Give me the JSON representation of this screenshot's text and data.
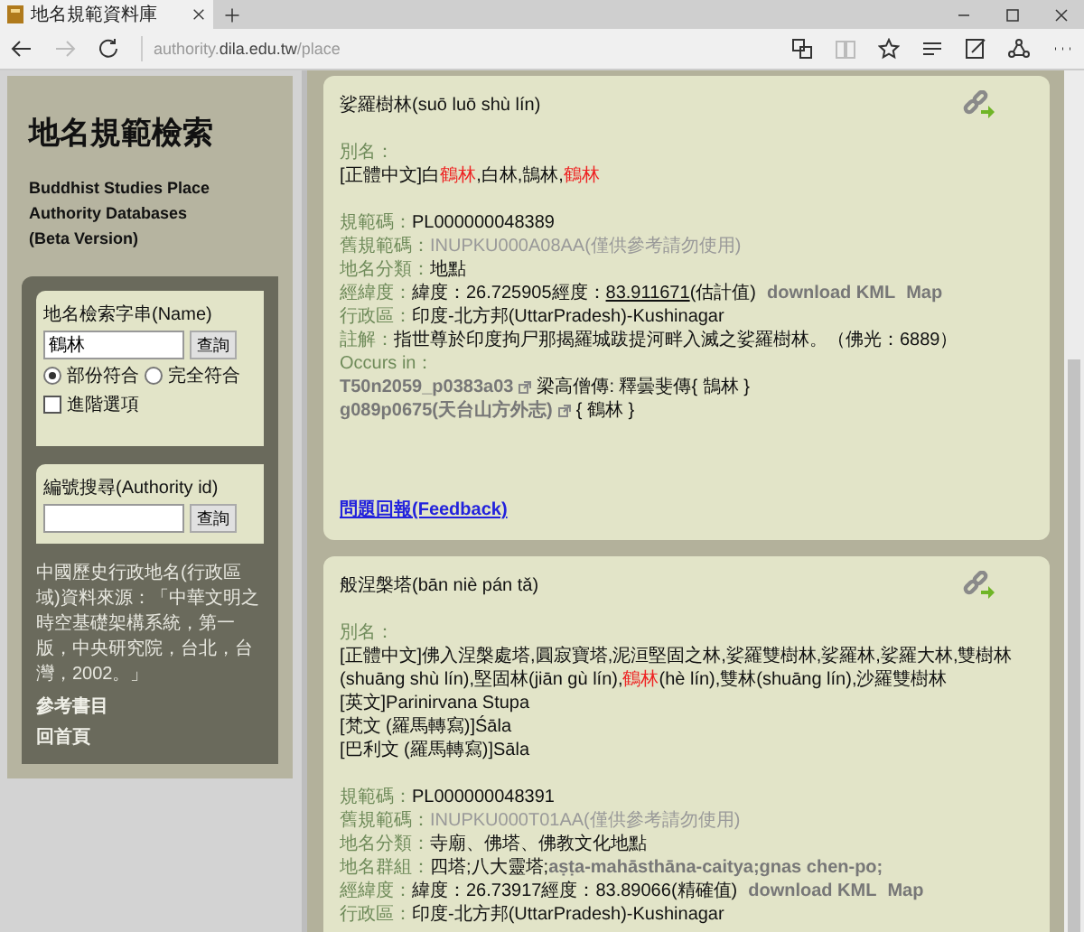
{
  "browser": {
    "tab_title": "地名規範資料庫",
    "url": {
      "prefix": "authority.",
      "domain": "dila.edu.tw",
      "path": "/place"
    }
  },
  "sidebar": {
    "title": "地名規範檢索",
    "subtitle": [
      "Buddhist Studies Place Authority Databases",
      "(Beta Version)"
    ],
    "name_search": {
      "label": "地名檢索字串(Name)",
      "value": "鶴林",
      "button": "查詢",
      "match_options": [
        {
          "label": "部份符合",
          "selected": true
        },
        {
          "label": "完全符合",
          "selected": false
        }
      ],
      "advanced": {
        "label": "進階選項",
        "checked": false
      }
    },
    "id_search": {
      "label": "編號搜尋(Authority id)",
      "button": "查詢"
    },
    "source_note": "中國歷史行政地名(行政區域)資料來源：「中華文明之時空基礎架構系統，第一版，中央研究院，台北，台灣，2002。」",
    "links": [
      "參考書目",
      "回首頁"
    ]
  },
  "entries": [
    {
      "title": "娑羅樹林(suō luō shù lín)",
      "alias_label": "別名：",
      "aliases": [
        [
          {
            "text": "[正體中文]白",
            "hit": false
          },
          {
            "text": "鶴林",
            "hit": true
          },
          {
            "text": ",白林,鵠林,",
            "hit": false
          },
          {
            "text": "鶴林",
            "hit": true
          }
        ]
      ],
      "fields": [
        {
          "kind": "plain",
          "label": "規範碼：",
          "value": "PL000000048389"
        },
        {
          "kind": "muted",
          "label": "舊規範碼：",
          "value": "INUPKU000A08AA(僅供參考請勿使用)"
        },
        {
          "kind": "plain",
          "label": "地名分類：",
          "value": "地點"
        },
        {
          "kind": "coords",
          "label": "經緯度：",
          "latitude": "緯度：26.725905",
          "longitude_label": "經度：",
          "longitude": "83.911671",
          "underlined": true,
          "note": "(估計值)",
          "links": [
            "download KML",
            "Map"
          ]
        },
        {
          "kind": "plain",
          "label": "行政區：",
          "value": "印度-北方邦(UttarPradesh)-Kushinagar"
        },
        {
          "kind": "plain",
          "label": "註解：",
          "value": "指世尊於印度拘尸那揭羅城跋提河畔入滅之娑羅樹林。（佛光：6889）"
        }
      ],
      "occurs_label": "Occurs in：",
      "occurrences": [
        {
          "ref": "T50n2059_p0383a03",
          "text": "梁高僧傳: 釋曇斐傳{ 鵠林 }"
        },
        {
          "ref": "g089p0675(天台山方外志)",
          "text": "{ 鶴林 }"
        }
      ],
      "feedback": "問題回報(Feedback)"
    },
    {
      "title": "般涅槃塔(bān niè pán tǎ)",
      "alias_label": "別名：",
      "aliases": [
        [
          {
            "text": "[正體中文]佛入涅槃處塔,圓寂寶塔,泥洹堅固之林,娑羅雙樹林,娑羅林,娑羅大林,雙樹林(shuāng shù lín),堅固林(jiān gù lín),",
            "hit": false
          },
          {
            "text": "鶴林",
            "hit": true
          },
          {
            "text": "(hè lín),雙林(shuāng lín),沙羅雙樹林",
            "hit": false
          }
        ],
        [
          {
            "text": "[英文]Parinirvana Stupa",
            "hit": false
          }
        ],
        [
          {
            "text": "[梵文 (羅馬轉寫)]Śāla",
            "hit": false
          }
        ],
        [
          {
            "text": "[巴利文 (羅馬轉寫)]Sāla",
            "hit": false
          }
        ]
      ],
      "fields": [
        {
          "kind": "plain",
          "label": "規範碼：",
          "value": "PL000000048391"
        },
        {
          "kind": "muted",
          "label": "舊規範碼：",
          "value": "INUPKU000T01AA(僅供參考請勿使用)"
        },
        {
          "kind": "plain",
          "label": "地名分類：",
          "value": "寺廟、佛塔、佛教文化地點"
        },
        {
          "kind": "group",
          "label": "地名群組：",
          "value": "四塔;八大靈塔;",
          "extra": "aṣṭa-mahāsthāna-caitya;gnas chen-po;"
        },
        {
          "kind": "coords",
          "label": "經緯度：",
          "latitude": "緯度：26.73917",
          "longitude_label": "經度：",
          "longitude": "83.89066",
          "underlined": false,
          "note": "(精確值)",
          "links": [
            "download KML",
            "Map"
          ]
        },
        {
          "kind": "plain",
          "label": "行政區：",
          "value": "印度-北方邦(UttarPradesh)-Kushinagar"
        }
      ]
    }
  ]
}
